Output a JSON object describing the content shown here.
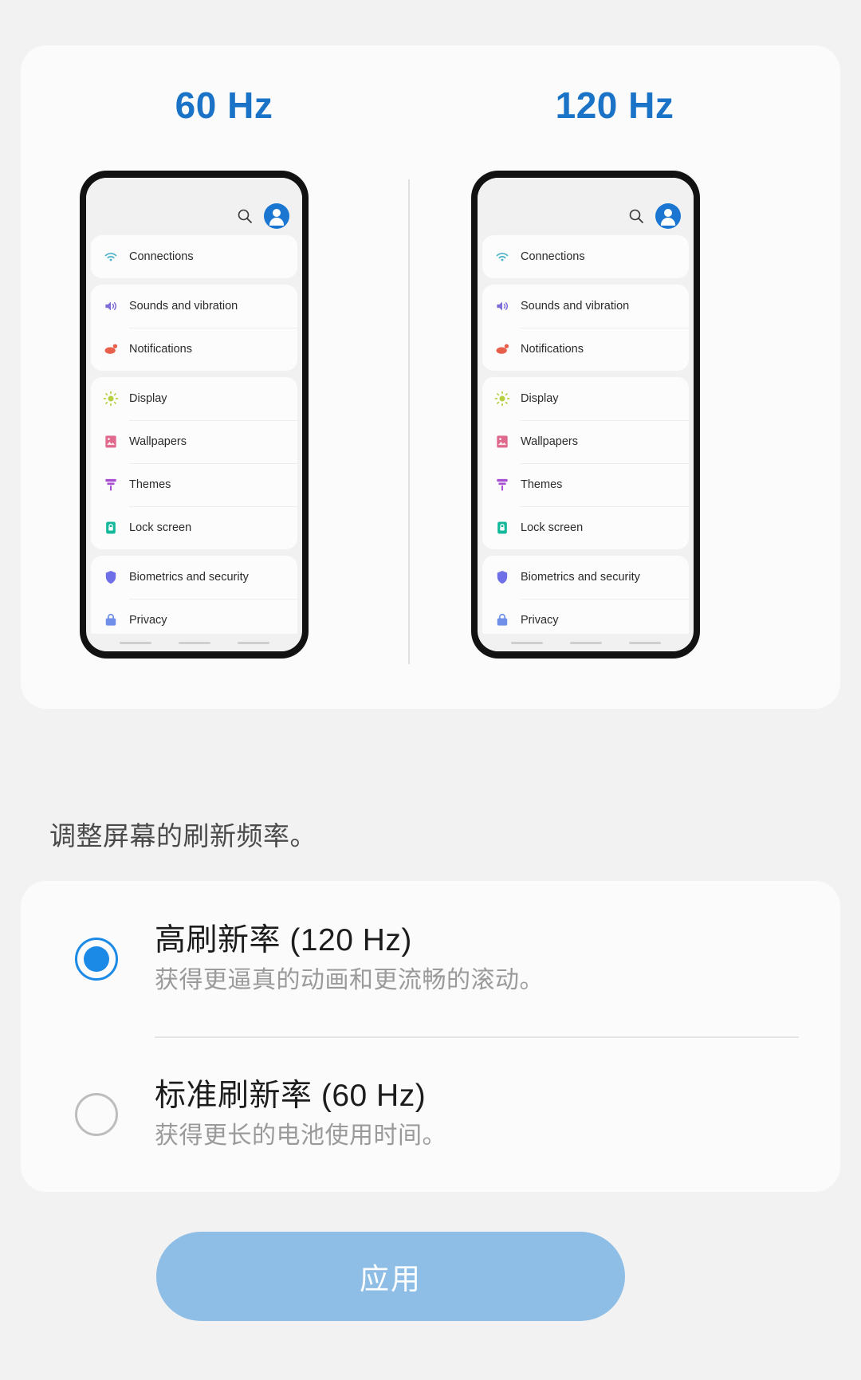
{
  "preview": {
    "left_label": "60 Hz",
    "right_label": "120 Hz",
    "accent_color": "#1a73c7",
    "phone": {
      "search_icon": "search-icon",
      "avatar_icon": "profile-avatar-icon",
      "groups": [
        {
          "rows": [
            {
              "label": "Connections",
              "icon": "wifi-icon",
              "color": "#4db3c8"
            }
          ]
        },
        {
          "rows": [
            {
              "label": "Sounds and vibration",
              "icon": "speaker-icon",
              "color": "#7e6fd8"
            },
            {
              "label": "Notifications",
              "icon": "bell-icon",
              "color": "#e8604c"
            }
          ]
        },
        {
          "rows": [
            {
              "label": "Display",
              "icon": "brightness-icon",
              "color": "#b5cf3f"
            },
            {
              "label": "Wallpapers",
              "icon": "image-icon",
              "color": "#e06a8e"
            },
            {
              "label": "Themes",
              "icon": "paint-roller-icon",
              "color": "#a64fd0"
            },
            {
              "label": "Lock screen",
              "icon": "lock-icon",
              "color": "#14b89b"
            }
          ]
        },
        {
          "rows": [
            {
              "label": "Biometrics and security",
              "icon": "shield-icon",
              "color": "#6f6fe8"
            },
            {
              "label": "Privacy",
              "icon": "privacy-lock-icon",
              "color": "#6f8fe8"
            }
          ]
        }
      ]
    }
  },
  "description": "调整屏幕的刷新频率。",
  "options": {
    "selected_index": 0,
    "items": [
      {
        "title": "高刷新率 (120 Hz)",
        "subtitle": "获得更逼真的动画和更流畅的滚动。",
        "selected": true
      },
      {
        "title": "标准刷新率 (60 Hz)",
        "subtitle": "获得更长的电池使用时间。",
        "selected": false
      }
    ]
  },
  "apply_button": {
    "label": "应用",
    "color": "#8ebde6"
  }
}
